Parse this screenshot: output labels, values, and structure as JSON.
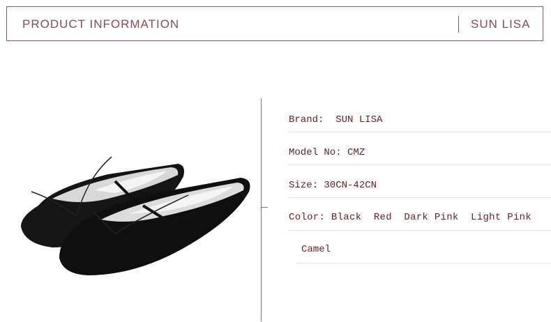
{
  "header": {
    "title": "PRODUCT INFORMATION",
    "brand": "SUN LISA"
  },
  "product": {
    "image_description": "Black canvas ballet shoes"
  },
  "specs": [
    {
      "text": "Brand:  SUN LISA"
    },
    {
      "text": "Model No: CMZ"
    },
    {
      "text": "Size: 30CN-42CN"
    },
    {
      "text": "Color: Black  Red  Dark Pink  Light Pink"
    },
    {
      "text": "Camel"
    }
  ]
}
